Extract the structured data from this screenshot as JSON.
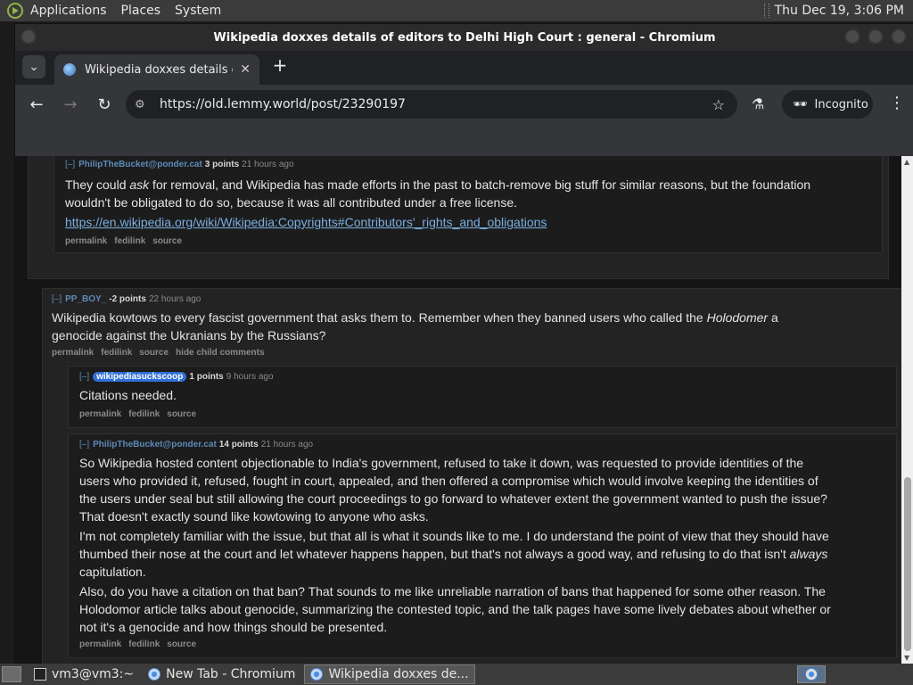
{
  "top_panel": {
    "menus": [
      "Applications",
      "Places",
      "System"
    ],
    "clock": "Thu Dec 19,  3:06 PM"
  },
  "window": {
    "title": "Wikipedia doxxes details of editors to Delhi High Court : general - Chromium"
  },
  "browser": {
    "tab_title": "Wikipedia doxxes details of e",
    "tab_close": "✕",
    "new_tab": "+",
    "url": "https://old.lemmy.world/post/23290197",
    "incognito_label": "Incognito"
  },
  "comments": {
    "c1": {
      "toggle": "[–]",
      "author": "PhilipTheBucket@ponder.cat",
      "points": "3 points",
      "time": "21 hours ago",
      "text_before_em": "They could ",
      "em": "ask",
      "text_after_em": " for removal, and Wikipedia has made efforts in the past to batch-remove big stuff for similar reasons, but the foundation wouldn't be obligated to do so, because it was all contributed under a free license.",
      "link": "https://en.wikipedia.org/wiki/Wikipedia:Copyrights#Contributors'_rights_and_obligations",
      "actions": [
        "permalink",
        "fedilink",
        "source"
      ]
    },
    "c2": {
      "toggle": "[–]",
      "author": "PP_BOY_",
      "points": "-2 points",
      "time": "22 hours ago",
      "text_before_em": "Wikipedia kowtows to every fascist government that asks them to. Remember when they banned users who called the ",
      "em": "Holodomer",
      "text_after_em": " a genocide against the Ukranians by the Russians?",
      "actions": [
        "permalink",
        "fedilink",
        "source",
        "hide child comments"
      ]
    },
    "c3": {
      "toggle": "[–]",
      "author": "wikipediasuckscoop",
      "points": "1 points",
      "time": "9 hours ago",
      "text": "Citations needed.",
      "actions": [
        "permalink",
        "fedilink",
        "source"
      ]
    },
    "c4": {
      "toggle": "[–]",
      "author": "PhilipTheBucket@ponder.cat",
      "points": "14 points",
      "time": "21 hours ago",
      "p1": "So Wikipedia hosted content objectionable to India's government, refused to take it down, was requested to provide identities of the users who provided it, refused, fought in court, appealed, and then offered a compromise which would involve keeping the identities of the users under seal but still allowing the court proceedings to go forward to whatever extent the government wanted to push the issue? That doesn't exactly sound like kowtowing to anyone who asks.",
      "p2_before_em": "I'm not completely familiar with the issue, but that all is what it sounds like to me. I do understand the point of view that they should have thumbed their nose at the court and let whatever happens happen, but that's not always a good way, and refusing to do that isn't ",
      "p2_em": "always",
      "p2_after_em": " capitulation.",
      "p3": "Also, do you have a citation on that ban? That sounds to me like unreliable narration of bans that happened for some other reason. The Holodomor article talks about genocide, summarizing the contested topic, and the talk pages have some lively debates about whether or not it's a genocide and how things should be presented.",
      "actions": [
        "permalink",
        "fedilink",
        "source"
      ]
    }
  },
  "taskbar": {
    "tasks": [
      "vm3@vm3:~",
      "New Tab - Chromium",
      "Wikipedia doxxes de..."
    ]
  }
}
